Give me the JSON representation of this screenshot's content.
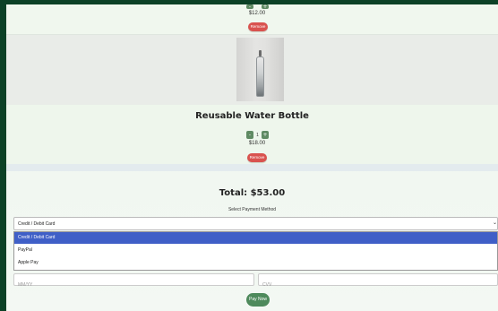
{
  "cart": {
    "items": [
      {
        "quantity": "",
        "price": "$12.00",
        "remove_label": "Remove"
      },
      {
        "name": "Reusable Water Bottle",
        "quantity": "1",
        "price": "$18.00",
        "remove_label": "Remove",
        "image": "water-bottle-photo"
      }
    ],
    "decrement_symbol": "-",
    "increment_symbol": "+"
  },
  "checkout": {
    "total": "Total: $53.00",
    "payment_label": "Select Payment Method",
    "selected_method": "Credit / Debit Card",
    "options": [
      "Credit / Debit Card",
      "PayPal",
      "Apple Pay"
    ],
    "expiry_placeholder": "MM/YY",
    "cvv_placeholder": "CVV",
    "pay_label": "Pay Now"
  },
  "colors": {
    "background": "#0c4126",
    "remove_button": "#d9534f",
    "qty_button": "#5f8a63",
    "pay_button": "#4e8a5c",
    "selected_option": "#3f5fc7"
  },
  "icons": {
    "select_chevron": "chevron-down-icon"
  }
}
